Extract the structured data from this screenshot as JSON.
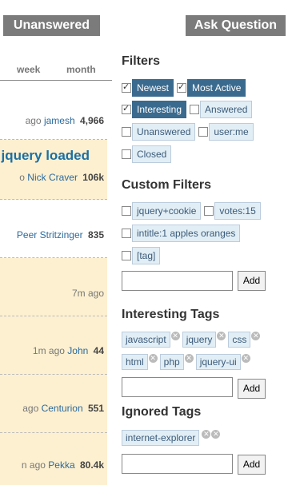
{
  "header": {
    "unanswered_label": "Unanswered",
    "ask_label": "Ask Question"
  },
  "left": {
    "tabs": [
      "week",
      "month"
    ],
    "rows": [
      {
        "time": "ago",
        "user": "jamesh",
        "rep": "4,966"
      },
      {
        "title": "jquery loaded",
        "time": "o",
        "user": "Nick Craver",
        "rep": "106k"
      },
      {
        "user": "Peer Stritzinger",
        "rep": "835"
      },
      {
        "time": "7m ago"
      },
      {
        "time": "1m ago",
        "user": "John",
        "rep": "44"
      },
      {
        "time": "ago",
        "user": "Centurion",
        "rep": "551"
      },
      {
        "time": "n ago",
        "user": "Pekka",
        "rep": "80.4k"
      }
    ]
  },
  "right": {
    "filters_title": "Filters",
    "filters": [
      {
        "label": "Newest",
        "checked": true,
        "selected": true
      },
      {
        "label": "Most Active",
        "checked": true,
        "selected": true
      },
      {
        "label": "Interesting",
        "checked": true,
        "selected": true
      },
      {
        "label": "Answered",
        "checked": false,
        "selected": false
      },
      {
        "label": "Unanswered",
        "checked": false,
        "selected": false
      },
      {
        "label": "user:me",
        "checked": false,
        "selected": false
      },
      {
        "label": "Closed",
        "checked": false,
        "selected": false
      }
    ],
    "custom_title": "Custom Filters",
    "custom": [
      {
        "label": "jquery+cookie"
      },
      {
        "label": "votes:15"
      },
      {
        "label": "intitle:1 apples oranges"
      },
      {
        "label": "[tag]"
      }
    ],
    "interesting_title": "Interesting Tags",
    "interesting_tags": [
      "javascript",
      "jquery",
      "css",
      "html",
      "php",
      "jquery-ui"
    ],
    "ignored_title": "Ignored Tags",
    "ignored_tags": [
      "internet-explorer"
    ],
    "add_label": "Add"
  },
  "colors": {
    "button_gray": "#7b7b7b",
    "row_highlight": "#fdf0d0",
    "selected_filter": "#3a6a8e",
    "tag_bg": "#e2eef5",
    "link": "#1b6fa3"
  }
}
